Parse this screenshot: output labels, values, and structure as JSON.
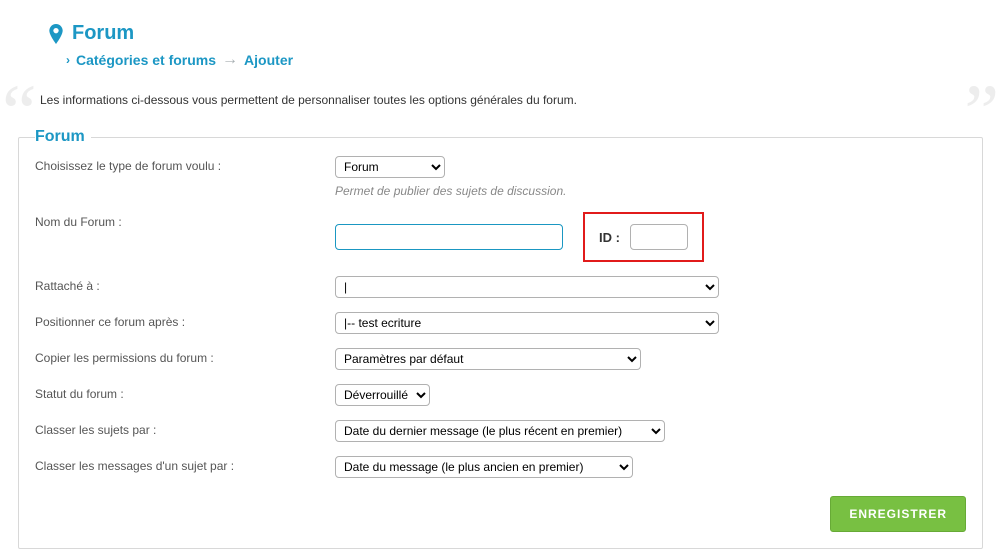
{
  "header": {
    "title": "Forum",
    "breadcrumb_item": "Catégories et forums",
    "breadcrumb_current": "Ajouter"
  },
  "intro": "Les informations ci-dessous vous permettent de personnaliser toutes les options générales du forum.",
  "panel": {
    "legend": "Forum",
    "type_label": "Choisissez le type de forum voulu :",
    "type_value": "Forum",
    "type_hint": "Permet de publier des sujets de discussion.",
    "name_label": "Nom du Forum :",
    "id_label": "ID :",
    "attached_label": "Rattaché à :",
    "attached_value": "|",
    "position_label": "Positionner ce forum après :",
    "position_value": "|-- test ecriture",
    "perms_label": "Copier les permissions du forum :",
    "perms_value": "Paramètres par défaut",
    "status_label": "Statut du forum :",
    "status_value": "Déverrouillé",
    "sort_subjects_label": "Classer les sujets par :",
    "sort_subjects_value": "Date du dernier message (le plus récent en premier)",
    "sort_msgs_label": "Classer les messages d'un sujet par :",
    "sort_msgs_value": "Date du message (le plus ancien en premier)",
    "save_label": "ENREGISTRER"
  }
}
